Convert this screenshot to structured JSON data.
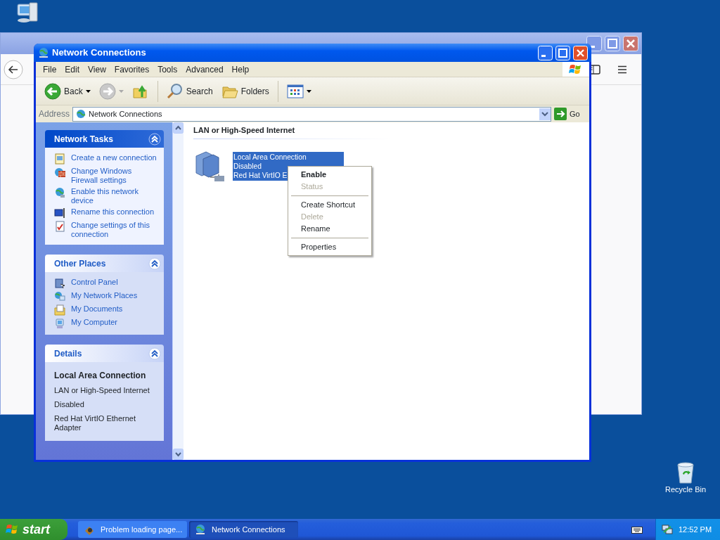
{
  "desktop": {
    "recycle_bin": "Recycle Bin"
  },
  "window": {
    "title": "Network Connections",
    "menu": [
      "File",
      "Edit",
      "View",
      "Favorites",
      "Tools",
      "Advanced",
      "Help"
    ],
    "toolbar": [
      {
        "kind": "back",
        "label": "Back"
      },
      {
        "kind": "forward"
      },
      {
        "kind": "up"
      },
      {
        "kind": "search",
        "label": "Search"
      },
      {
        "kind": "folders",
        "label": "Folders"
      },
      {
        "kind": "views"
      }
    ],
    "address": {
      "label": "Address",
      "value": "Network Connections",
      "go": "Go"
    },
    "task_panes": [
      {
        "title": "Network Tasks",
        "kind": "special",
        "items": [
          {
            "kind": "link",
            "text": "Create a new connection"
          },
          {
            "kind": "link",
            "text": "Change Windows Firewall settings"
          },
          {
            "kind": "link",
            "text": "Enable this network device"
          },
          {
            "kind": "link",
            "text": "Rename this connection"
          },
          {
            "kind": "link",
            "text": "Change settings of this connection"
          }
        ]
      },
      {
        "title": "Other Places",
        "kind": "normal",
        "items": [
          {
            "kind": "link",
            "text": "Control Panel"
          },
          {
            "kind": "link",
            "text": "My Network Places"
          },
          {
            "kind": "link",
            "text": "My Documents"
          },
          {
            "kind": "link",
            "text": "My Computer"
          }
        ]
      },
      {
        "title": "Details",
        "kind": "normal",
        "items": [
          {
            "kind": "heading",
            "text": "Local Area Connection"
          },
          {
            "kind": "text",
            "text": "LAN or High-Speed Internet"
          },
          {
            "kind": "text",
            "text": "Disabled"
          },
          {
            "kind": "text",
            "text": "Red Hat VirtIO Ethernet Adapter"
          }
        ]
      }
    ],
    "content": {
      "group": "LAN or High-Speed Internet",
      "connections": [
        {
          "lines": [
            "Local Area Connection",
            "Disabled",
            "Red Hat VirtIO E"
          ],
          "selected": true
        }
      ]
    }
  },
  "context_menu": [
    {
      "kind": "item",
      "label": "Enable",
      "default": true,
      "disabled": false
    },
    {
      "kind": "item",
      "label": "Status",
      "default": false,
      "disabled": true
    },
    {
      "kind": "separator"
    },
    {
      "kind": "item",
      "label": "Create Shortcut",
      "default": false,
      "disabled": false
    },
    {
      "kind": "item",
      "label": "Delete",
      "default": false,
      "disabled": true
    },
    {
      "kind": "item",
      "label": "Rename",
      "default": false,
      "disabled": false
    },
    {
      "kind": "separator"
    },
    {
      "kind": "item",
      "label": "Properties",
      "default": false,
      "disabled": false
    }
  ],
  "taskbar": {
    "start": "start",
    "tasks": [
      {
        "label": "Problem loading page...",
        "selected": false
      },
      {
        "label": "Network Connections",
        "selected": true
      }
    ],
    "clock": "12:52 PM"
  }
}
